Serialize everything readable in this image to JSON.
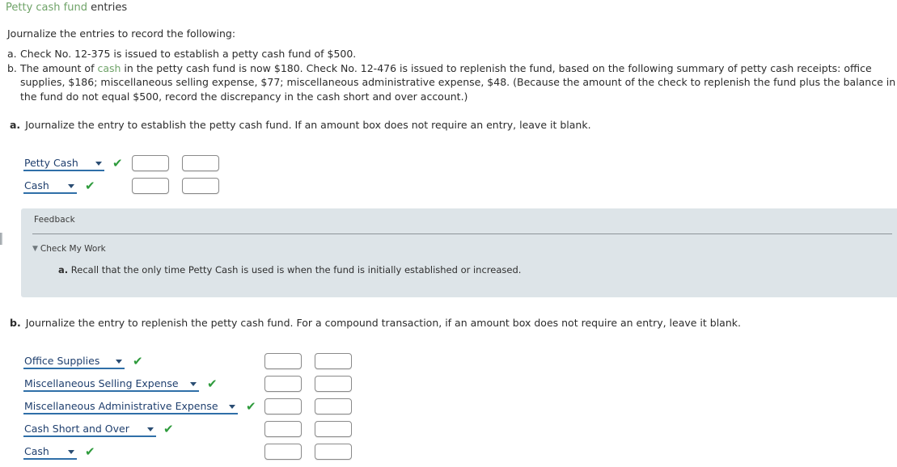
{
  "title": {
    "highlight": "Petty cash fund",
    "rest": " entries"
  },
  "intro": "Journalize the entries to record the following:",
  "problem_items": [
    {
      "marker": "a.",
      "text": "Check No. 12-375 is issued to establish a petty cash fund of $500."
    },
    {
      "marker": "b.",
      "text_before_link": "The amount of ",
      "link": "cash",
      "text_after_link": " in the petty cash fund is now $180. Check No. 12-476 is issued to replenish the fund, based on the following summary of petty cash receipts: office supplies, $186; miscellaneous selling expense, $77; miscellaneous administrative expense, $48. (Because the amount of the check to replenish the fund plus the balance in the fund do not equal $500, record the discrepancy in the cash short and over account.)"
    }
  ],
  "part_a": {
    "label": "a.",
    "prompt": "Journalize the entry to establish the petty cash fund. If an amount box does not require an entry, leave it blank.",
    "rows": [
      {
        "account": "Petty Cash",
        "validated": true,
        "debit": "",
        "credit": ""
      },
      {
        "account": "Cash",
        "validated": true,
        "debit": "",
        "credit": ""
      }
    ]
  },
  "feedback": {
    "title": "Feedback",
    "check_my_work": "Check My Work",
    "body_label": "a.",
    "body_text": " Recall that the only time Petty Cash is used is when the fund is initially established or increased."
  },
  "part_b": {
    "label": "b.",
    "prompt": "Journalize the entry to replenish the petty cash fund. For a compound transaction, if an amount box does not require an entry, leave it blank.",
    "rows": [
      {
        "account": "Office Supplies",
        "validated": true,
        "debit": "",
        "credit": ""
      },
      {
        "account": "Miscellaneous Selling Expense",
        "validated": true,
        "debit": "",
        "credit": ""
      },
      {
        "account": "Miscellaneous Administrative Expense",
        "validated": true,
        "debit": "",
        "credit": ""
      },
      {
        "account": "Cash Short and Over",
        "validated": true,
        "debit": "",
        "credit": ""
      },
      {
        "account": "Cash",
        "validated": true,
        "debit": "",
        "credit": ""
      }
    ]
  },
  "icons": {
    "check": "✔",
    "caret_down": "▼"
  },
  "colors": {
    "glossary_green": "#6fa368",
    "check_green": "#2e9b3c",
    "select_underline": "#2f6fa8",
    "select_text": "#1f3f6e",
    "feedback_bg": "#dde4e8"
  }
}
